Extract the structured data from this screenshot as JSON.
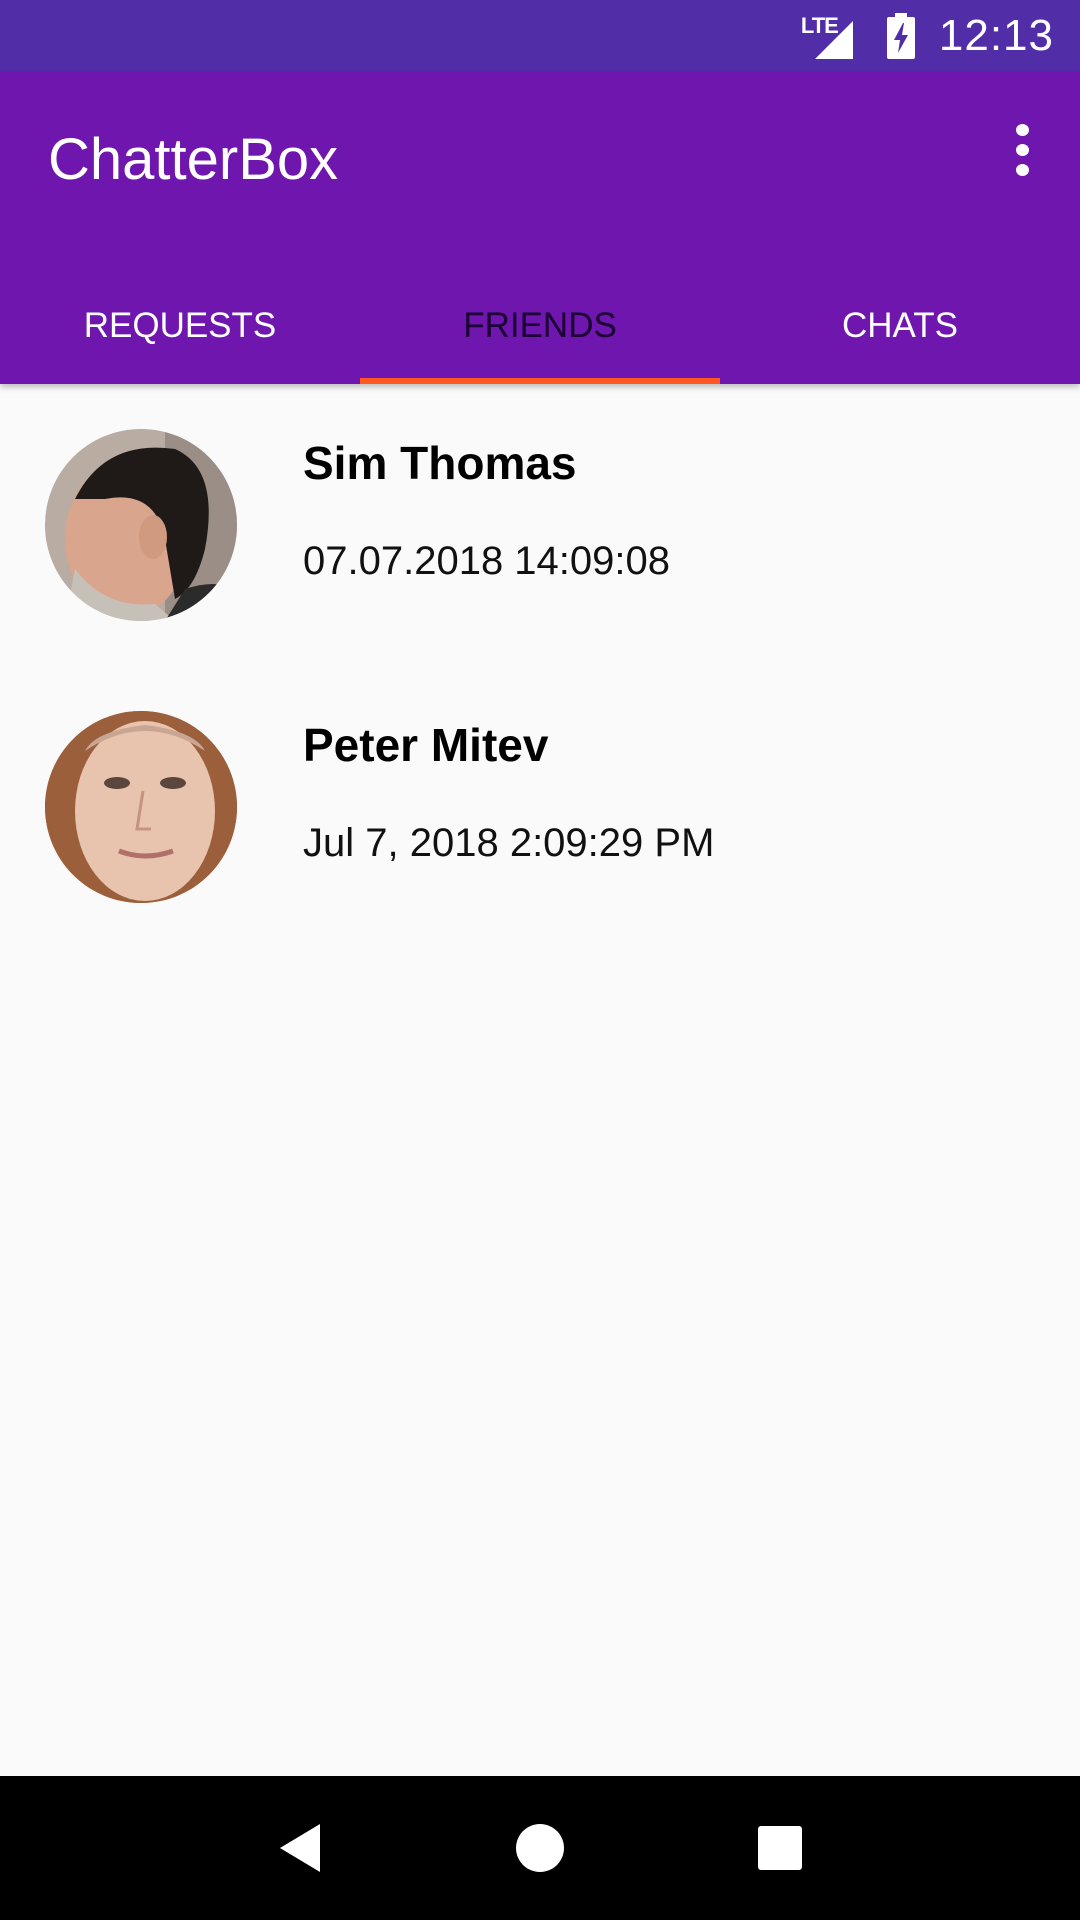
{
  "status_bar": {
    "network": "LTE",
    "time": "12:13",
    "icons": [
      "lte-signal-icon",
      "battery-charging-icon"
    ]
  },
  "app_bar": {
    "title": "ChatterBox",
    "overflow_icon": "more-vert-icon"
  },
  "tabs": [
    {
      "label": "REQUESTS",
      "active": false
    },
    {
      "label": "FRIENDS",
      "active": true
    },
    {
      "label": "CHATS",
      "active": false
    }
  ],
  "friends": [
    {
      "name": "Sim Thomas",
      "date": "07.07.2018 14:09:08"
    },
    {
      "name": "Peter Mitev",
      "date": "Jul 7, 2018 2:09:29 PM"
    }
  ],
  "nav_bar": {
    "icons": [
      "back-icon",
      "home-icon",
      "recents-icon"
    ]
  },
  "colors": {
    "status_bar": "#512da8",
    "app_bar": "#6e16ad",
    "tab_indicator": "#ff5722",
    "background": "#fafafa"
  }
}
